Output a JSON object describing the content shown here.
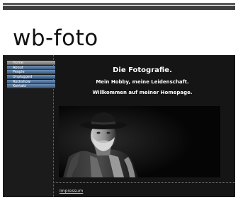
{
  "site": {
    "logo_text": "wb-foto"
  },
  "sidebar": {
    "items": [
      {
        "label": "Home",
        "active": true
      },
      {
        "label": "About",
        "active": false
      },
      {
        "label": "People",
        "active": false
      },
      {
        "label": "Unplugged",
        "active": false
      },
      {
        "label": "Rockshow",
        "active": false
      },
      {
        "label": "Kontakt",
        "active": false
      }
    ]
  },
  "main": {
    "title": "Die Fotografie.",
    "subtitle_1": "Mein Hobby, meine Leidenschaft.",
    "subtitle_2": "Willkommen auf meiner Homepage."
  },
  "footer": {
    "link_label": "Impressum"
  },
  "colors": {
    "nav_blue": "#4f7099",
    "nav_active": "#8f8f8f",
    "content_bg": "#151515"
  },
  "icons": {
    "logo_underline": "brush-stroke-icon"
  }
}
